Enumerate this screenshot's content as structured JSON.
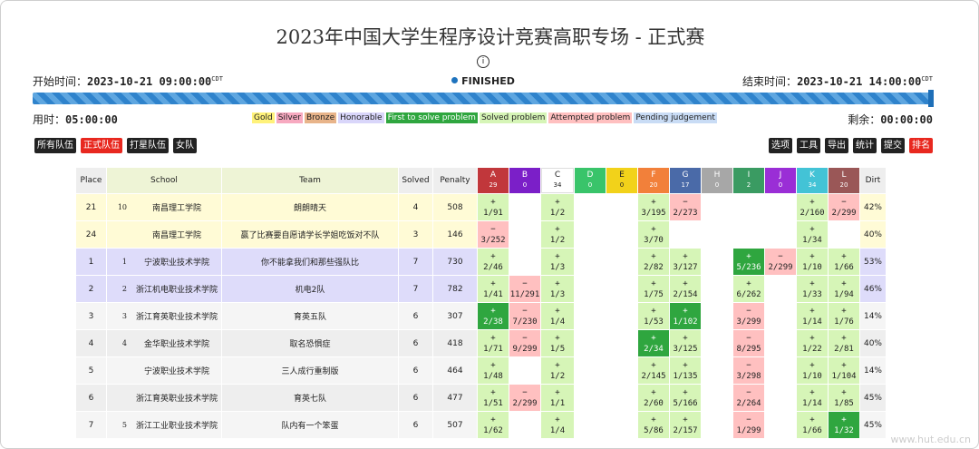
{
  "title": "2023年中国大学生程序设计竞赛高职专场 - 正式赛",
  "start_label": "开始时间：",
  "start_value": "2023-10-21 09:00:00",
  "end_label": "结束时间：",
  "end_value": "2023-10-21 14:00:00",
  "tz": "CDT",
  "status": "FINISHED",
  "elapsed_label": "用时：",
  "elapsed_value": "05:00:00",
  "remaining_label": "剩余：",
  "remaining_value": "00:00:00",
  "progress": 1.0,
  "legend": [
    "Gold",
    "Silver",
    "Bronze",
    "Honorable",
    "First to solve problem",
    "Solved problem",
    "Attempted problem",
    "Pending judgement"
  ],
  "filters": [
    "所有队伍",
    "正式队伍",
    "打星队伍",
    "女队"
  ],
  "tools": [
    "选项",
    "工具",
    "导出",
    "统计",
    "提交",
    "排名"
  ],
  "headers": {
    "place": "Place",
    "school": "School",
    "team": "Team",
    "solved": "Solved",
    "penalty": "Penalty",
    "dirt": "Dirt"
  },
  "problems": [
    {
      "id": "A",
      "count": "29",
      "color": "#c1373b",
      "text": "#ffffff"
    },
    {
      "id": "B",
      "count": "0",
      "color": "#7b1fc8",
      "text": "#ffffff"
    },
    {
      "id": "C",
      "count": "34",
      "color": "#ffffff",
      "text": "#222222"
    },
    {
      "id": "D",
      "count": "0",
      "color": "#39c46a",
      "text": "#ffffff"
    },
    {
      "id": "E",
      "count": "0",
      "color": "#f2d21a",
      "text": "#222222"
    },
    {
      "id": "F",
      "count": "20",
      "color": "#f2803a",
      "text": "#ffffff"
    },
    {
      "id": "G",
      "count": "17",
      "color": "#4a6aa8",
      "text": "#ffffff"
    },
    {
      "id": "H",
      "count": "0",
      "color": "#a7a7a7",
      "text": "#ffffff"
    },
    {
      "id": "I",
      "count": "2",
      "color": "#3a9b62",
      "text": "#ffffff"
    },
    {
      "id": "J",
      "count": "0",
      "color": "#9a2ed6",
      "text": "#ffffff"
    },
    {
      "id": "K",
      "count": "34",
      "color": "#43c3d6",
      "text": "#ffffff"
    },
    {
      "id": "L",
      "count": "20",
      "color": "#9a5757",
      "text": "#ffffff"
    }
  ],
  "rows": [
    {
      "place": "21",
      "rank": "10",
      "school": "南昌理工学院",
      "team": "朗朗晴天",
      "solved": "4",
      "penalty": "508",
      "dirt": "42%",
      "bg": "#fffbd6",
      "cells": [
        [
          "+",
          "1/91",
          "ac"
        ],
        null,
        [
          "+",
          "1/2",
          "ac"
        ],
        null,
        null,
        [
          "+",
          "3/195",
          "ac"
        ],
        [
          "−",
          "2/273",
          "wa"
        ],
        null,
        null,
        null,
        [
          "+",
          "2/160",
          "ac"
        ],
        [
          "−",
          "2/299",
          "wa"
        ]
      ]
    },
    {
      "place": "24",
      "rank": "",
      "school": "南昌理工学院",
      "team": "赢了比赛要自愿请学长学姐吃饭对不队",
      "solved": "3",
      "penalty": "146",
      "dirt": "40%",
      "bg": "#fffbd6",
      "cells": [
        [
          "−",
          "3/252",
          "wa"
        ],
        null,
        [
          "+",
          "1/2",
          "ac"
        ],
        null,
        null,
        [
          "+",
          "3/70",
          "ac"
        ],
        null,
        null,
        null,
        null,
        [
          "+",
          "1/34",
          "ac"
        ],
        null
      ]
    },
    {
      "place": "1",
      "rank": "1",
      "school": "宁波职业技术学院",
      "team": "你不能拿我们和那些强队比",
      "solved": "7",
      "penalty": "730",
      "dirt": "53%",
      "bg": "#dedcfa",
      "cells": [
        [
          "+",
          "2/46",
          "ac"
        ],
        null,
        [
          "+",
          "1/3",
          "ac"
        ],
        null,
        null,
        [
          "+",
          "2/82",
          "ac"
        ],
        [
          "+",
          "3/127",
          "ac"
        ],
        null,
        [
          "+",
          "5/236",
          "fb"
        ],
        [
          "−",
          "2/299",
          "wa"
        ],
        [
          "+",
          "1/10",
          "ac"
        ],
        [
          "+",
          "1/66",
          "ac"
        ]
      ]
    },
    {
      "place": "2",
      "rank": "2",
      "school": "浙江机电职业技术学院",
      "team": "机电2队",
      "solved": "7",
      "penalty": "782",
      "dirt": "46%",
      "bg": "#dedcfa",
      "cells": [
        [
          "+",
          "1/41",
          "ac"
        ],
        [
          "−",
          "11/291",
          "wa"
        ],
        [
          "+",
          "1/3",
          "ac"
        ],
        null,
        null,
        [
          "+",
          "1/75",
          "ac"
        ],
        [
          "+",
          "2/154",
          "ac"
        ],
        null,
        [
          "+",
          "6/262",
          "ac"
        ],
        null,
        [
          "+",
          "1/33",
          "ac"
        ],
        [
          "+",
          "1/94",
          "ac"
        ]
      ]
    },
    {
      "place": "3",
      "rank": "3",
      "school": "浙江育英职业技术学院",
      "team": "育英五队",
      "solved": "6",
      "penalty": "307",
      "dirt": "14%",
      "bg": "#f5f5f5",
      "cells": [
        [
          "+",
          "2/38",
          "fb"
        ],
        [
          "−",
          "7/230",
          "wa"
        ],
        [
          "+",
          "1/4",
          "ac"
        ],
        null,
        null,
        [
          "+",
          "1/53",
          "ac"
        ],
        [
          "+",
          "1/102",
          "fb"
        ],
        null,
        [
          "−",
          "3/299",
          "wa"
        ],
        null,
        [
          "+",
          "1/14",
          "ac"
        ],
        [
          "+",
          "1/76",
          "ac"
        ]
      ]
    },
    {
      "place": "4",
      "rank": "4",
      "school": "金华职业技术学院",
      "team": "取名恐惧症",
      "solved": "6",
      "penalty": "418",
      "dirt": "40%",
      "bg": "#eeeeee",
      "cells": [
        [
          "+",
          "1/71",
          "ac"
        ],
        [
          "−",
          "9/299",
          "wa"
        ],
        [
          "+",
          "1/5",
          "ac"
        ],
        null,
        null,
        [
          "+",
          "2/34",
          "fb"
        ],
        [
          "+",
          "3/125",
          "ac"
        ],
        null,
        [
          "−",
          "8/295",
          "wa"
        ],
        null,
        [
          "+",
          "1/22",
          "ac"
        ],
        [
          "+",
          "2/81",
          "ac"
        ]
      ]
    },
    {
      "place": "5",
      "rank": "",
      "school": "宁波职业技术学院",
      "team": "三人成行重制版",
      "solved": "6",
      "penalty": "464",
      "dirt": "14%",
      "bg": "#f5f5f5",
      "cells": [
        [
          "+",
          "1/48",
          "ac"
        ],
        null,
        [
          "+",
          "1/2",
          "ac"
        ],
        null,
        null,
        [
          "+",
          "2/145",
          "ac"
        ],
        [
          "+",
          "1/135",
          "ac"
        ],
        null,
        [
          "−",
          "3/298",
          "wa"
        ],
        null,
        [
          "+",
          "1/10",
          "ac"
        ],
        [
          "+",
          "1/104",
          "ac"
        ]
      ]
    },
    {
      "place": "6",
      "rank": "",
      "school": "浙江育英职业技术学院",
      "team": "育英七队",
      "solved": "6",
      "penalty": "477",
      "dirt": "45%",
      "bg": "#eeeeee",
      "cells": [
        [
          "+",
          "1/51",
          "ac"
        ],
        [
          "−",
          "2/299",
          "wa"
        ],
        [
          "+",
          "1/1",
          "ac"
        ],
        null,
        null,
        [
          "+",
          "2/60",
          "ac"
        ],
        [
          "+",
          "5/166",
          "ac"
        ],
        null,
        [
          "−",
          "2/264",
          "wa"
        ],
        null,
        [
          "+",
          "1/14",
          "ac"
        ],
        [
          "+",
          "1/85",
          "ac"
        ]
      ]
    },
    {
      "place": "7",
      "rank": "5",
      "school": "浙江工业职业技术学院",
      "team": "队内有一个笨蛋",
      "solved": "6",
      "penalty": "507",
      "dirt": "45%",
      "bg": "#f5f5f5",
      "cells": [
        [
          "+",
          "1/62",
          "ac"
        ],
        null,
        [
          "+",
          "1/4",
          "ac"
        ],
        null,
        null,
        [
          "+",
          "5/86",
          "ac"
        ],
        [
          "+",
          "2/157",
          "ac"
        ],
        null,
        [
          "−",
          "1/299",
          "wa"
        ],
        null,
        [
          "+",
          "1/66",
          "ac"
        ],
        [
          "+",
          "1/32",
          "fb"
        ]
      ]
    }
  ],
  "watermark": "www.hut.edu.cn"
}
